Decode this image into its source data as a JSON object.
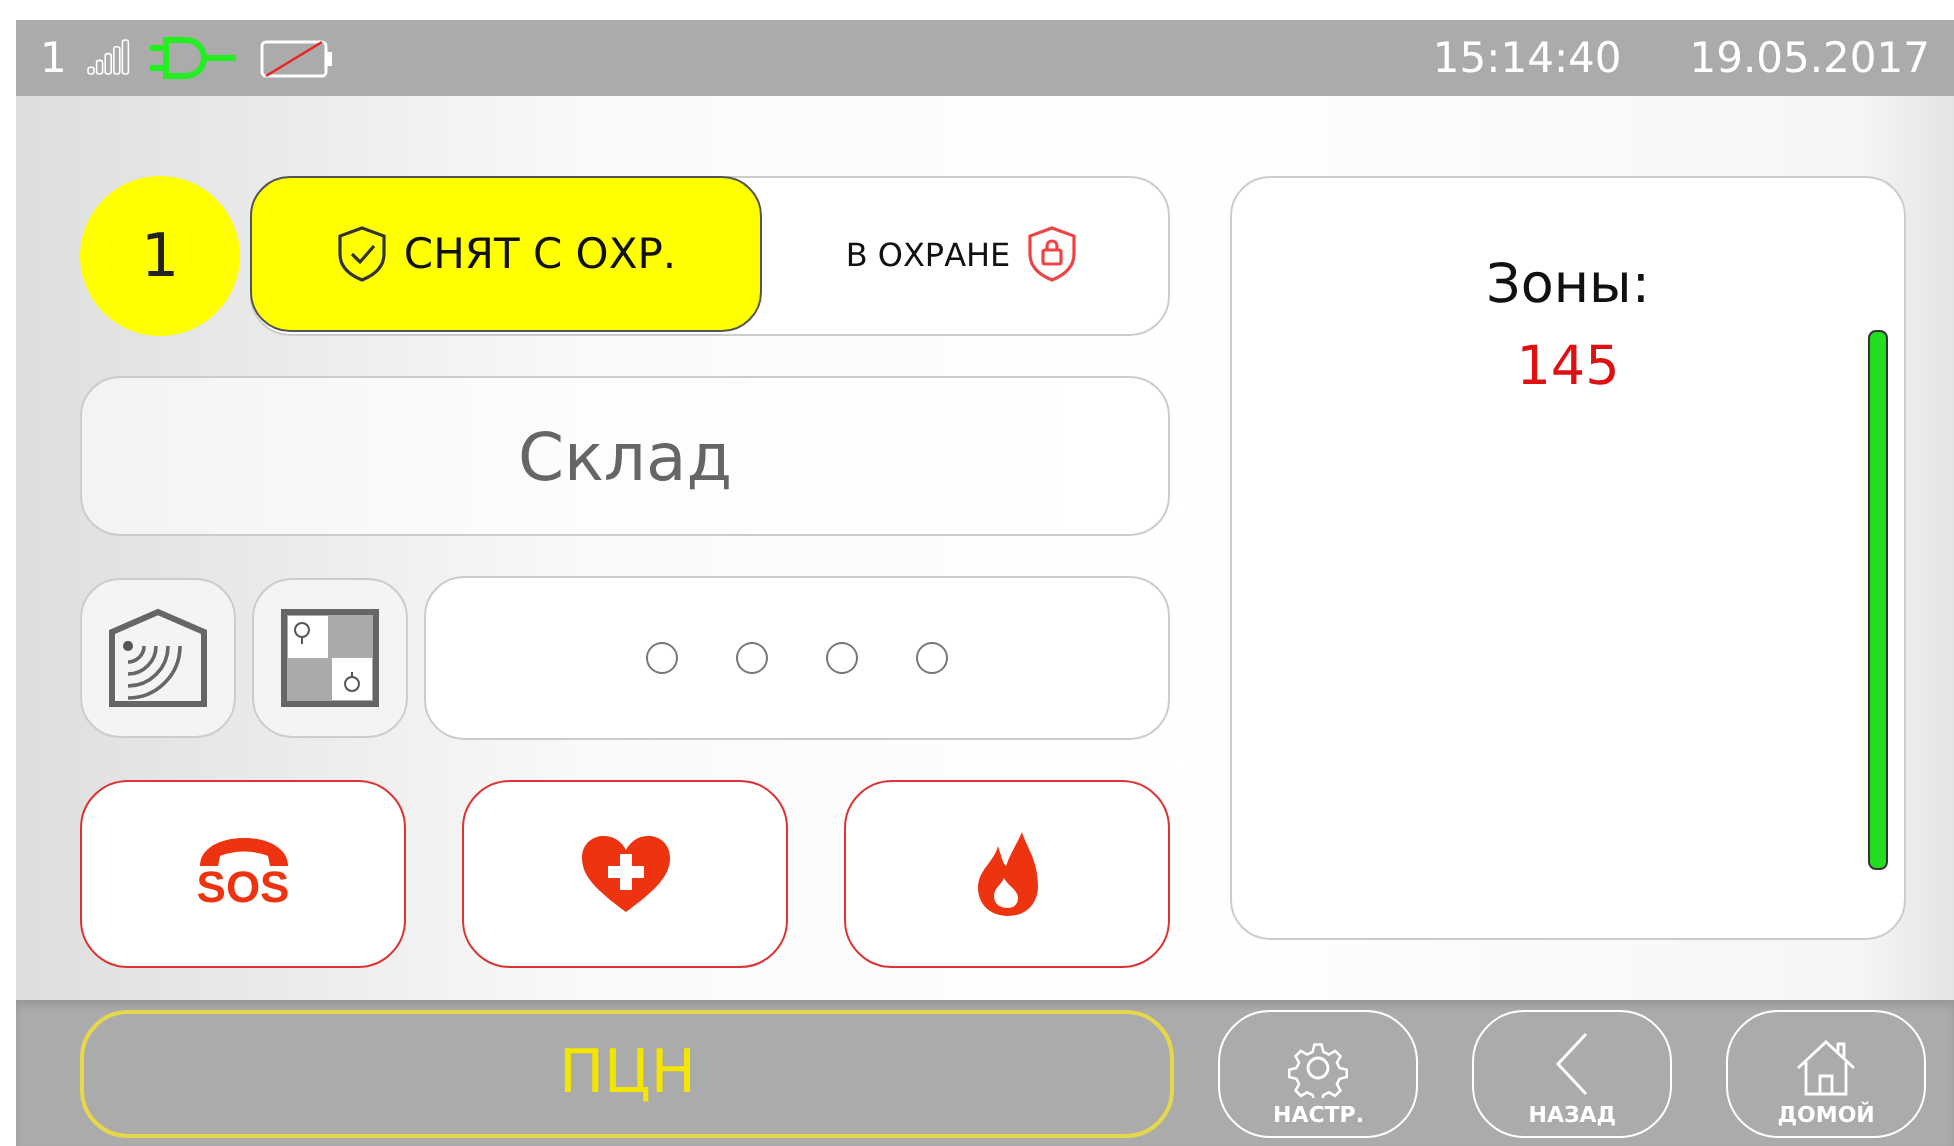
{
  "status_bar": {
    "sim": "1",
    "time": "15:14:40",
    "date": "19.05.2017"
  },
  "partition": {
    "number": "1",
    "modes": [
      {
        "label": "СНЯТ С ОХР.",
        "kind": "disarmed",
        "selected": true
      },
      {
        "label": "В ОХРАНЕ",
        "kind": "armed",
        "selected": false
      }
    ]
  },
  "object_name": "Склад",
  "indicators": [
    {
      "on": false
    },
    {
      "on": false
    },
    {
      "on": false
    },
    {
      "on": false
    }
  ],
  "alarm_buttons": [
    {
      "kind": "sos",
      "label": "SOS"
    },
    {
      "kind": "medical"
    },
    {
      "kind": "fire"
    }
  ],
  "zones_panel": {
    "title": "Зоны:",
    "value": "145"
  },
  "bottom_bar": {
    "pcn": "ПЦН",
    "nav": [
      {
        "kind": "settings",
        "label": "НАСТР."
      },
      {
        "kind": "back",
        "label": "НАЗАД"
      },
      {
        "kind": "home",
        "label": "ДОМОЙ"
      }
    ]
  }
}
